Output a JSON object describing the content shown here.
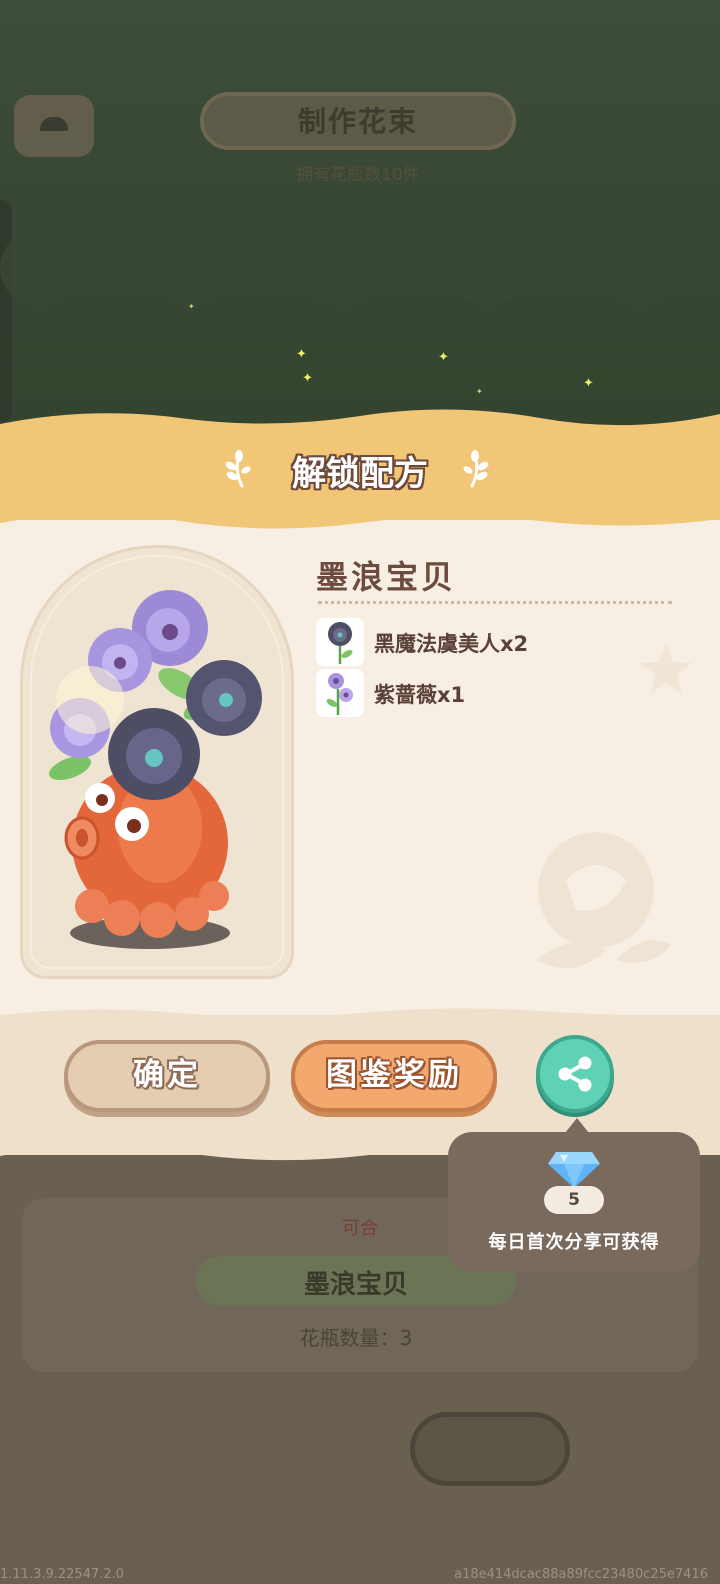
{
  "background": {
    "title": "制作花束",
    "subtitle": "拥有花瓶数10件",
    "card_tag": "可合",
    "card_name": "墨浪宝贝",
    "card_count": "花瓶数量：3"
  },
  "modal": {
    "title": "解锁配方",
    "recipe_name": "墨浪宝贝",
    "ingredients": [
      {
        "label": "黑魔法虞美人x2",
        "icon": "black-poppy-icon"
      },
      {
        "label": "紫蔷薇x1",
        "icon": "purple-rose-icon"
      }
    ],
    "buttons": {
      "confirm": "确定",
      "reward": "图鉴奖励",
      "share_icon": "share-icon"
    },
    "tooltip": {
      "gem_count": "5",
      "text": "每日首次分享可获得"
    }
  },
  "footer": {
    "version": "1.11.3.9.22547.2.0",
    "hash": "a18e414dcac88a89fcc23480c25e7416"
  },
  "colors": {
    "header": "#f2c677",
    "panel": "#f7efe3",
    "confirm_button": "#e4cdb0",
    "reward_button": "#f3a86e",
    "share_button": "#5fd1b5",
    "tooltip": "#7a6a5e"
  }
}
